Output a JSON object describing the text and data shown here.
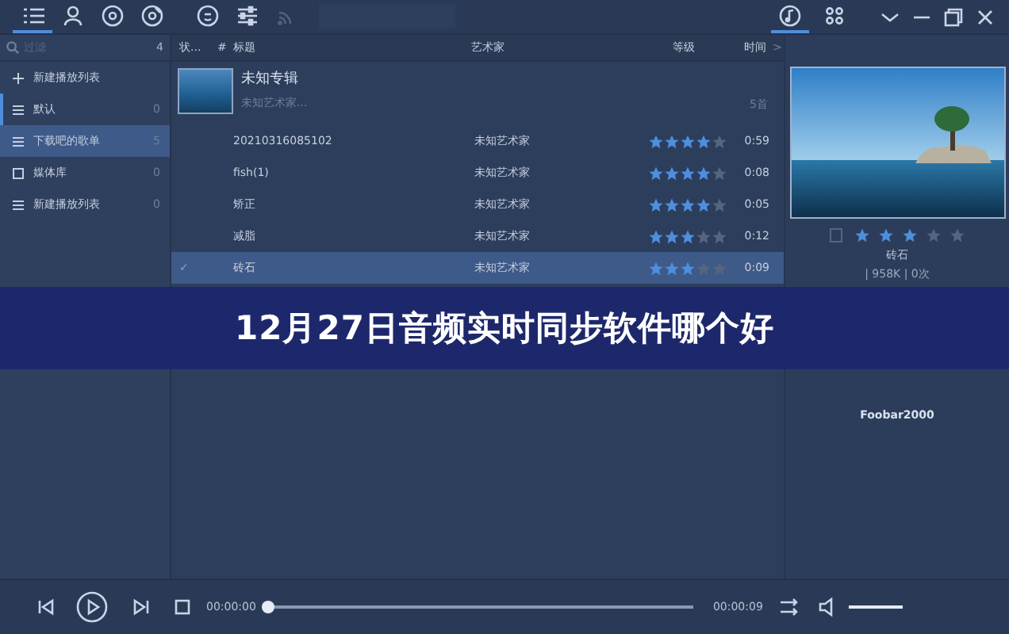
{
  "toolbar": {
    "tabs": [
      {
        "selected": true
      },
      {
        "selected": false
      },
      {
        "selected": false
      },
      {
        "selected": false
      },
      {
        "selected": false
      },
      {
        "selected": false
      },
      {
        "selected": false
      }
    ],
    "right_tabs": [
      {
        "selected": true
      },
      {
        "selected": false
      }
    ]
  },
  "sidebar": {
    "search": {
      "placeholder": "过滤",
      "count": "4"
    },
    "items": [
      {
        "kind": "add",
        "label": "新建播放列表",
        "selected": false
      },
      {
        "kind": "list",
        "label": "默认",
        "count": "0",
        "selected": false
      },
      {
        "kind": "list",
        "label": "下载吧的歌单",
        "count": "5",
        "selected": true
      },
      {
        "kind": "library",
        "label": "媒体库",
        "count": "0",
        "selected": false
      },
      {
        "kind": "list",
        "label": "新建播放列表",
        "count": "0",
        "selected": false
      }
    ]
  },
  "table": {
    "columns": [
      "状...",
      "#",
      "标题",
      "艺术家",
      "等级",
      "时间"
    ],
    "more": ">",
    "album": {
      "title": "未知专辑",
      "artist": "未知艺术家...",
      "count": "5首"
    },
    "rows": [
      {
        "title": "20210316085102",
        "artist": "未知艺术家",
        "stars": 4,
        "time": "0:59",
        "selected": false
      },
      {
        "title": "fish(1)",
        "artist": "未知艺术家",
        "stars": 4,
        "time": "0:08",
        "selected": false
      },
      {
        "title": "矫正",
        "artist": "未知艺术家",
        "stars": 4,
        "time": "0:05",
        "selected": false
      },
      {
        "title": "减脂",
        "artist": "未知艺术家",
        "stars": 3,
        "time": "0:12",
        "selected": false
      },
      {
        "status": "✓",
        "title": "砖石",
        "artist": "未知艺术家",
        "stars": 3,
        "time": "0:09",
        "selected": true
      }
    ]
  },
  "now_playing": {
    "stars": 3,
    "title": "砖石",
    "info": "| 958K | 0次",
    "player": "Foobar2000"
  },
  "player": {
    "elapsed": "00:00:00",
    "total": "00:00:09",
    "progress": {
      "level": 0
    },
    "volume": {
      "level": 1
    }
  },
  "banner": {
    "title": "12月27日音频实时同步软件哪个好"
  }
}
